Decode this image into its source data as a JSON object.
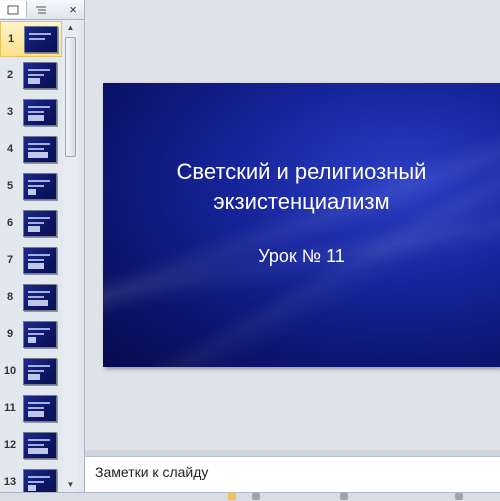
{
  "panel": {
    "tab_slides_icon": "slides-tab-icon",
    "tab_outline_icon": "outline-tab-icon",
    "close_glyph": "×"
  },
  "thumbnails": [
    {
      "num": "1",
      "selected": true
    },
    {
      "num": "2"
    },
    {
      "num": "3"
    },
    {
      "num": "4"
    },
    {
      "num": "5"
    },
    {
      "num": "6"
    },
    {
      "num": "7"
    },
    {
      "num": "8"
    },
    {
      "num": "9"
    },
    {
      "num": "10"
    },
    {
      "num": "11"
    },
    {
      "num": "12"
    },
    {
      "num": "13"
    }
  ],
  "slide": {
    "title_line1": "Светский и религиозный",
    "title_line2": "экзистенциализм",
    "subtitle": "Урок № 11"
  },
  "notes": {
    "placeholder": "Заметки к слайду"
  },
  "colors": {
    "slide_bg": "#0b136b",
    "selection": "#fde28c"
  }
}
